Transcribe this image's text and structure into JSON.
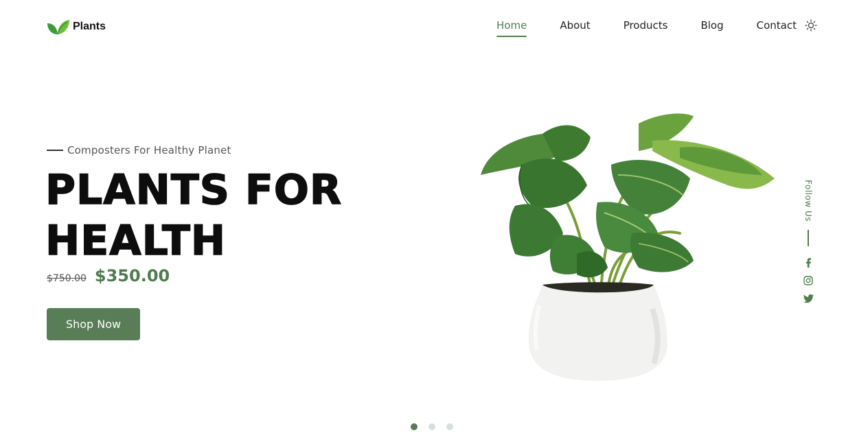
{
  "brand": {
    "name": "Plants",
    "logo_icon": "leaf-icon",
    "accent": "#4f7c4e",
    "button_color": "#587d57"
  },
  "nav": {
    "items": [
      {
        "label": "Home",
        "active": true
      },
      {
        "label": "About",
        "active": false
      },
      {
        "label": "Products",
        "active": false
      },
      {
        "label": "Blog",
        "active": false
      },
      {
        "label": "Contact",
        "active": false
      }
    ],
    "theme_icon": "sun-icon"
  },
  "hero": {
    "subtitle": "Composters For Healthy Planet",
    "title_line1": "PLANTS FOR",
    "title_line2": "HEALTH",
    "old_price": "$750.00",
    "new_price": "$350.00",
    "cta_label": "Shop Now",
    "image_icon": "potted-plant-image"
  },
  "social": {
    "label": "Follow Us",
    "icons": [
      "facebook-icon",
      "instagram-icon",
      "twitter-icon"
    ]
  },
  "slider": {
    "count": 3,
    "active_index": 0
  }
}
